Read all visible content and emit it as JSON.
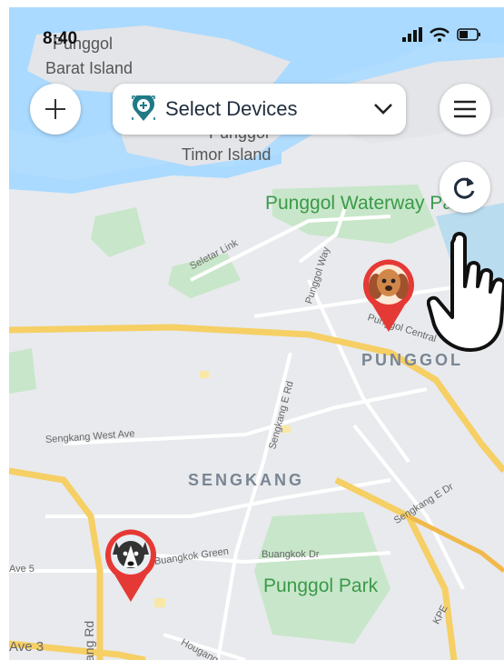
{
  "status_bar": {
    "time": "8:40"
  },
  "toolbar": {
    "add_icon": "plus-icon",
    "device_select": {
      "label": "Select Devices",
      "icon": "location-plus-icon",
      "chevron": "chevron-down-icon"
    },
    "menu_icon": "hamburger-menu-icon",
    "refresh_icon": "refresh-icon"
  },
  "map": {
    "places": {
      "punggol_barat_1": "Punggol",
      "punggol_barat_2": "Barat Island",
      "punggol_timor_1": "Punggol",
      "punggol_timor_2": "Timor Island",
      "waterway_park": "Punggol Waterway Park",
      "punggol": "PUNGGOL",
      "sengkang": "SENGKANG",
      "punggol_park": "Punggol Park"
    },
    "roads": {
      "seletar_link": "Seletar Link",
      "punggol_way": "Punggol Way",
      "punggol_central": "Punggol Central",
      "sengkang_e_rd": "Sengkang E Rd",
      "sengkang_west_ave": "Sengkang West Ave",
      "sengkang_e_dr": "Sengkang E Dr",
      "buangkok_green": "Buangkok Green",
      "buangkok_dr": "Buangkok Dr",
      "ave5": "Ave 5",
      "ave3": "Ave 3",
      "hougang": "Hougang",
      "kpe": "KPE",
      "rd_vertical": "ang Rd"
    }
  },
  "markers": [
    {
      "name": "dog-brown",
      "icon": "brown-dog-icon"
    },
    {
      "name": "dog-husky",
      "icon": "husky-dog-icon"
    }
  ],
  "colors": {
    "pin": "#e53935",
    "water": "#aadaff",
    "park": "#c8e6c9",
    "highway": "#f6cf65",
    "accent": "#1f7a86"
  }
}
